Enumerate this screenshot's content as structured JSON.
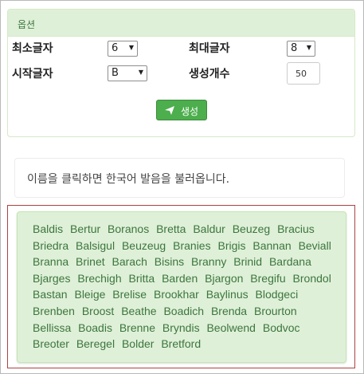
{
  "options": {
    "title": "옵션",
    "min_length": {
      "label": "최소글자",
      "value": "6"
    },
    "max_length": {
      "label": "최대글자",
      "value": "8"
    },
    "start_letter": {
      "label": "시작글자",
      "value": "B"
    },
    "count": {
      "label": "생성개수",
      "value": "50"
    },
    "generate_label": "생성"
  },
  "info": {
    "text": "이름을 클릭하면 한국어 발음을 불러옵니다."
  },
  "names": [
    "Baldis",
    "Bertur",
    "Boranos",
    "Bretta",
    "Baldur",
    "Beuzeg",
    "Bracius",
    "Briedra",
    "Balsigul",
    "Beuzeug",
    "Branies",
    "Brigis",
    "Bannan",
    "Beviall",
    "Branna",
    "Brinet",
    "Barach",
    "Bisins",
    "Branny",
    "Brinid",
    "Bardana",
    "Bjarges",
    "Brechigh",
    "Britta",
    "Barden",
    "Bjargon",
    "Bregifu",
    "Brondol",
    "Bastan",
    "Bleige",
    "Brelise",
    "Brookhar",
    "Baylinus",
    "Blodgeci",
    "Brenben",
    "Broost",
    "Beathe",
    "Boadich",
    "Brenda",
    "Brourton",
    "Bellissa",
    "Boadis",
    "Brenne",
    "Bryndis",
    "Beolwend",
    "Bodvoc",
    "Breoter",
    "Beregel",
    "Bolder",
    "Bretford"
  ],
  "colors": {
    "panel_heading_bg": "#dff0d8",
    "results_bg": "#dff0d8",
    "name_text": "#3c763d",
    "button_bg": "#4cae4c",
    "results_border": "#a94442"
  }
}
